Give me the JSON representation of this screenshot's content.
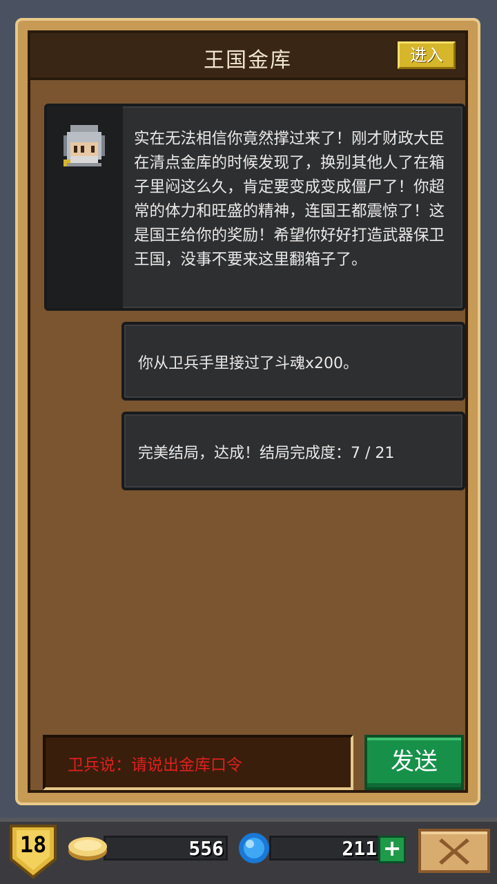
{
  "header": {
    "title": "王国金库",
    "enter_label": "进入"
  },
  "messages": [
    {
      "speaker_icon": "knight-helmet-portrait",
      "text": "实在无法相信你竟然撑过来了！刚才财政大臣在清点金库的时候发现了，换别其他人了在箱子里闷这么久，肯定要变成变成僵尸了！你超常的体力和旺盛的精神，连国王都震惊了！这是国王给你的奖励！希望你好好打造武器保卫王国，没事不要来这里翻箱子了。"
    },
    {
      "text": "你从卫兵手里接过了斗魂x200。"
    },
    {
      "text": "完美结局，达成！结局完成度：7 / 21"
    }
  ],
  "input": {
    "text": "卫兵说：请说出金库口令"
  },
  "send_label": "发送",
  "status_bar": {
    "level": "18",
    "coins": "556",
    "gems": "211",
    "coin_icon": "gold-coin-icon",
    "gem_icon": "blue-gem-icon"
  },
  "colors": {
    "panel": "#7a5530",
    "frame": "#c79a55",
    "enter_button": "#d6b62a",
    "send_button": "#17914a",
    "input_text": "#e02020"
  }
}
